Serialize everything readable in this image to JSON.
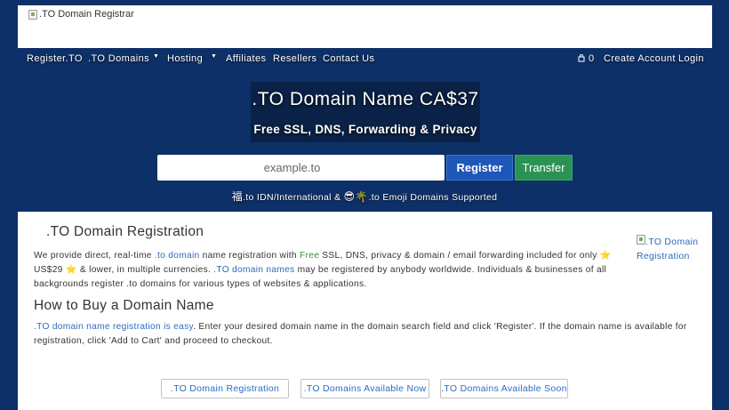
{
  "header": {
    "logo_alt": ".TO Domain Registrar"
  },
  "nav": {
    "items": [
      {
        "label": "Register.TO"
      },
      {
        "label": ".TO Domains"
      },
      {
        "label": "Hosting"
      },
      {
        "label": "Affiliates"
      },
      {
        "label": "Resellers"
      },
      {
        "label": "Contact Us"
      }
    ],
    "cart_count": "0",
    "create_account": "Create Account",
    "login": "Login"
  },
  "hero": {
    "title": ".TO Domain Name CA$37",
    "subtitle": "Free SSL, DNS, Forwarding & Privacy",
    "search_placeholder": "example.to",
    "register_label": "Register",
    "transfer_label": "Transfer",
    "idn_char": "福",
    "support_a": ".to IDN/International & ",
    "emoji_1": "😎",
    "emoji_2": "🌴",
    "support_b": ".to Emoji Domains Supported"
  },
  "main": {
    "heading": ".TO Domain Registration",
    "side_image_alt": ".TO Domain Registration",
    "intro": {
      "t1": "We provide direct, real-time ",
      "l1": ".to domain",
      "t2": " name registration with ",
      "free": "Free",
      "t3": " SSL, DNS, privacy & domain / email forwarding included for only ",
      "star": "⭐",
      "t4": " US$29 ",
      "t5": " & lower, in multiple currencies. ",
      "l2": ".TO domain names",
      "t6": " may be registered by anybody worldwide. Individuals & businesses of all backgrounds register .to domains for various types of websites & applications."
    },
    "how_heading": "How to Buy a Domain Name",
    "how": {
      "l1": ".TO domain name registration is easy",
      "t1": ". Enter your desired domain name in the domain search field and click 'Register'. If the domain name is available for registration, click 'Add to Cart' and proceed to checkout."
    },
    "buttons": [
      {
        "label": ".TO Domain Registration"
      },
      {
        "label": ".TO Domains Available Now"
      },
      {
        "label": ".TO Domains Available Soon"
      }
    ]
  },
  "colors": {
    "background": "#0d3068",
    "register_button": "#1d57b8",
    "transfer_button": "#2a9353",
    "link": "#2d6bbe"
  }
}
